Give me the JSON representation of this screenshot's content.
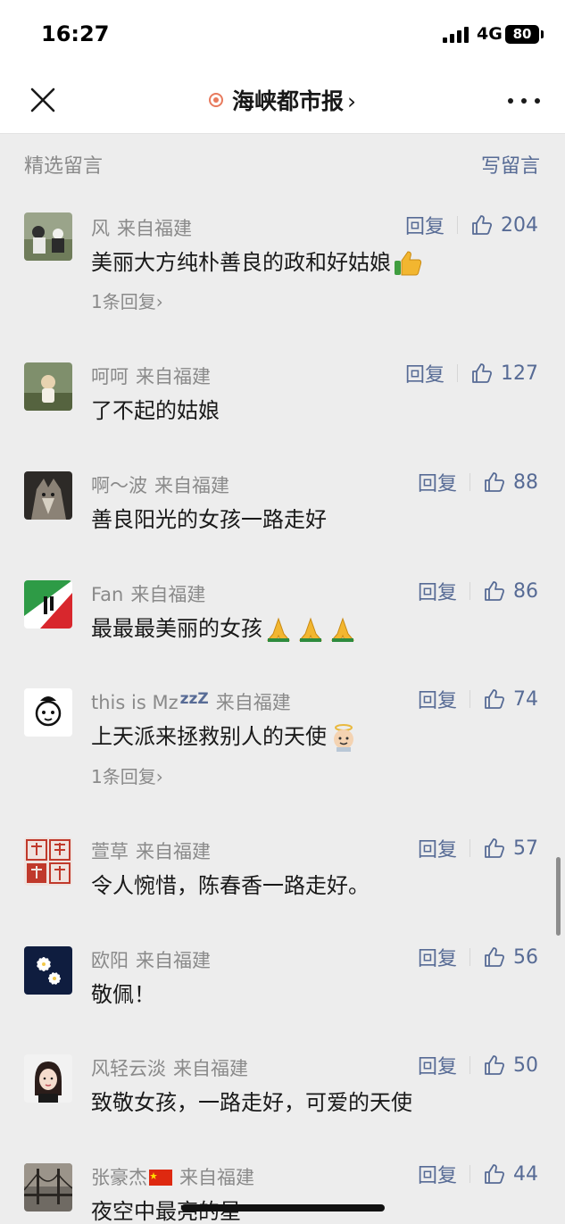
{
  "status_bar": {
    "time": "16:27",
    "network": "4G",
    "battery": "80"
  },
  "nav": {
    "title": "海峡都市报",
    "chevron": "›"
  },
  "section": {
    "title": "精选留言",
    "write": "写留言"
  },
  "comments": [
    {
      "name": "风",
      "from": "来自福建",
      "text": "美丽大方纯朴善良的政和好姑娘",
      "emoji": "thumbs-up",
      "reply": "回复",
      "likes": "204",
      "replies": "1条回复›"
    },
    {
      "name": "呵呵",
      "from": "来自福建",
      "text": "了不起的姑娘",
      "reply": "回复",
      "likes": "127"
    },
    {
      "name": "啊～波",
      "from": "来自福建",
      "text": "善良阳光的女孩一路走好",
      "reply": "回复",
      "likes": "88"
    },
    {
      "name": "Fan",
      "from": "来自福建",
      "text": "最最最美丽的女孩",
      "emoji": "praying-hands x3",
      "reply": "回复",
      "likes": "86"
    },
    {
      "name": "this is Mz",
      "name_suffix": "zzZ",
      "from": "来自福建",
      "text": "上天派来拯救别人的天使",
      "emoji": "angel",
      "reply": "回复",
      "likes": "74",
      "replies": "1条回复›"
    },
    {
      "name": "萱草",
      "from": "来自福建",
      "text": "令人惋惜，陈春香一路走好。",
      "reply": "回复",
      "likes": "57"
    },
    {
      "name": "欧阳",
      "from": "来自福建",
      "text": "敬佩！",
      "reply": "回复",
      "likes": "56"
    },
    {
      "name": "风轻云淡",
      "from": "来自福建",
      "text": "致敬女孩，一路走好，可爱的天使",
      "reply": "回复",
      "likes": "50"
    },
    {
      "name": "张豪杰",
      "name_flag": "china-flag",
      "from": "来自福建",
      "text": "夜空中最亮的星",
      "reply": "回复",
      "likes": "44"
    }
  ],
  "colors": {
    "link": "#576b95",
    "muted": "#8a8a8a",
    "background": "#ededed",
    "accent": "#e87a5d"
  }
}
